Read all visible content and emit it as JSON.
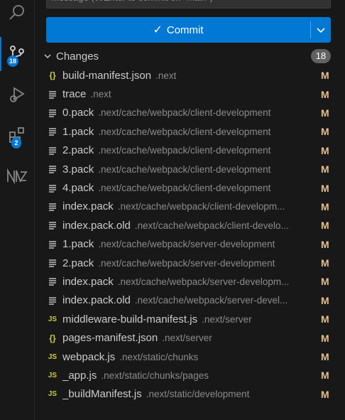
{
  "activity_bar": {
    "items": [
      {
        "icon": "search-icon"
      },
      {
        "icon": "source-control-icon",
        "badge": "18"
      },
      {
        "icon": "run-debug-icon"
      },
      {
        "icon": "extensions-icon",
        "badge": "2"
      },
      {
        "icon": "nx-console-icon"
      }
    ]
  },
  "scm": {
    "message_placeholder": "Message (⌘Enter to commit on \"main\")",
    "commit_label": "Commit",
    "commit_check": "✓",
    "changes_label": "Changes",
    "changes_count": "18",
    "files": [
      {
        "name": "build-manifest.json",
        "path": ".next",
        "type": "json",
        "status": "M"
      },
      {
        "name": "trace",
        "path": ".next",
        "type": "text",
        "status": "M"
      },
      {
        "name": "0.pack",
        "path": ".next/cache/webpack/client-development",
        "type": "text",
        "status": "M"
      },
      {
        "name": "1.pack",
        "path": ".next/cache/webpack/client-development",
        "type": "text",
        "status": "M"
      },
      {
        "name": "2.pack",
        "path": ".next/cache/webpack/client-development",
        "type": "text",
        "status": "M"
      },
      {
        "name": "3.pack",
        "path": ".next/cache/webpack/client-development",
        "type": "text",
        "status": "M"
      },
      {
        "name": "4.pack",
        "path": ".next/cache/webpack/client-development",
        "type": "text",
        "status": "M"
      },
      {
        "name": "index.pack",
        "path": ".next/cache/webpack/client-developm...",
        "type": "text",
        "status": "M"
      },
      {
        "name": "index.pack.old",
        "path": ".next/cache/webpack/client-develo...",
        "type": "text",
        "status": "M"
      },
      {
        "name": "1.pack",
        "path": ".next/cache/webpack/server-development",
        "type": "text",
        "status": "M"
      },
      {
        "name": "2.pack",
        "path": ".next/cache/webpack/server-development",
        "type": "text",
        "status": "M"
      },
      {
        "name": "index.pack",
        "path": ".next/cache/webpack/server-developm...",
        "type": "text",
        "status": "M"
      },
      {
        "name": "index.pack.old",
        "path": ".next/cache/webpack/server-devel...",
        "type": "text",
        "status": "M"
      },
      {
        "name": "middleware-build-manifest.js",
        "path": ".next/server",
        "type": "js",
        "status": "M"
      },
      {
        "name": "pages-manifest.json",
        "path": ".next/server",
        "type": "json",
        "status": "M"
      },
      {
        "name": "webpack.js",
        "path": ".next/static/chunks",
        "type": "js",
        "status": "M"
      },
      {
        "name": "_app.js",
        "path": ".next/static/chunks/pages",
        "type": "js",
        "status": "M"
      },
      {
        "name": "_buildManifest.js",
        "path": ".next/static/development",
        "type": "js",
        "status": "M"
      }
    ]
  },
  "colors": {
    "accent": "#0078d4",
    "modified": "#e2c08d",
    "js_icon": "#cbcb41"
  }
}
